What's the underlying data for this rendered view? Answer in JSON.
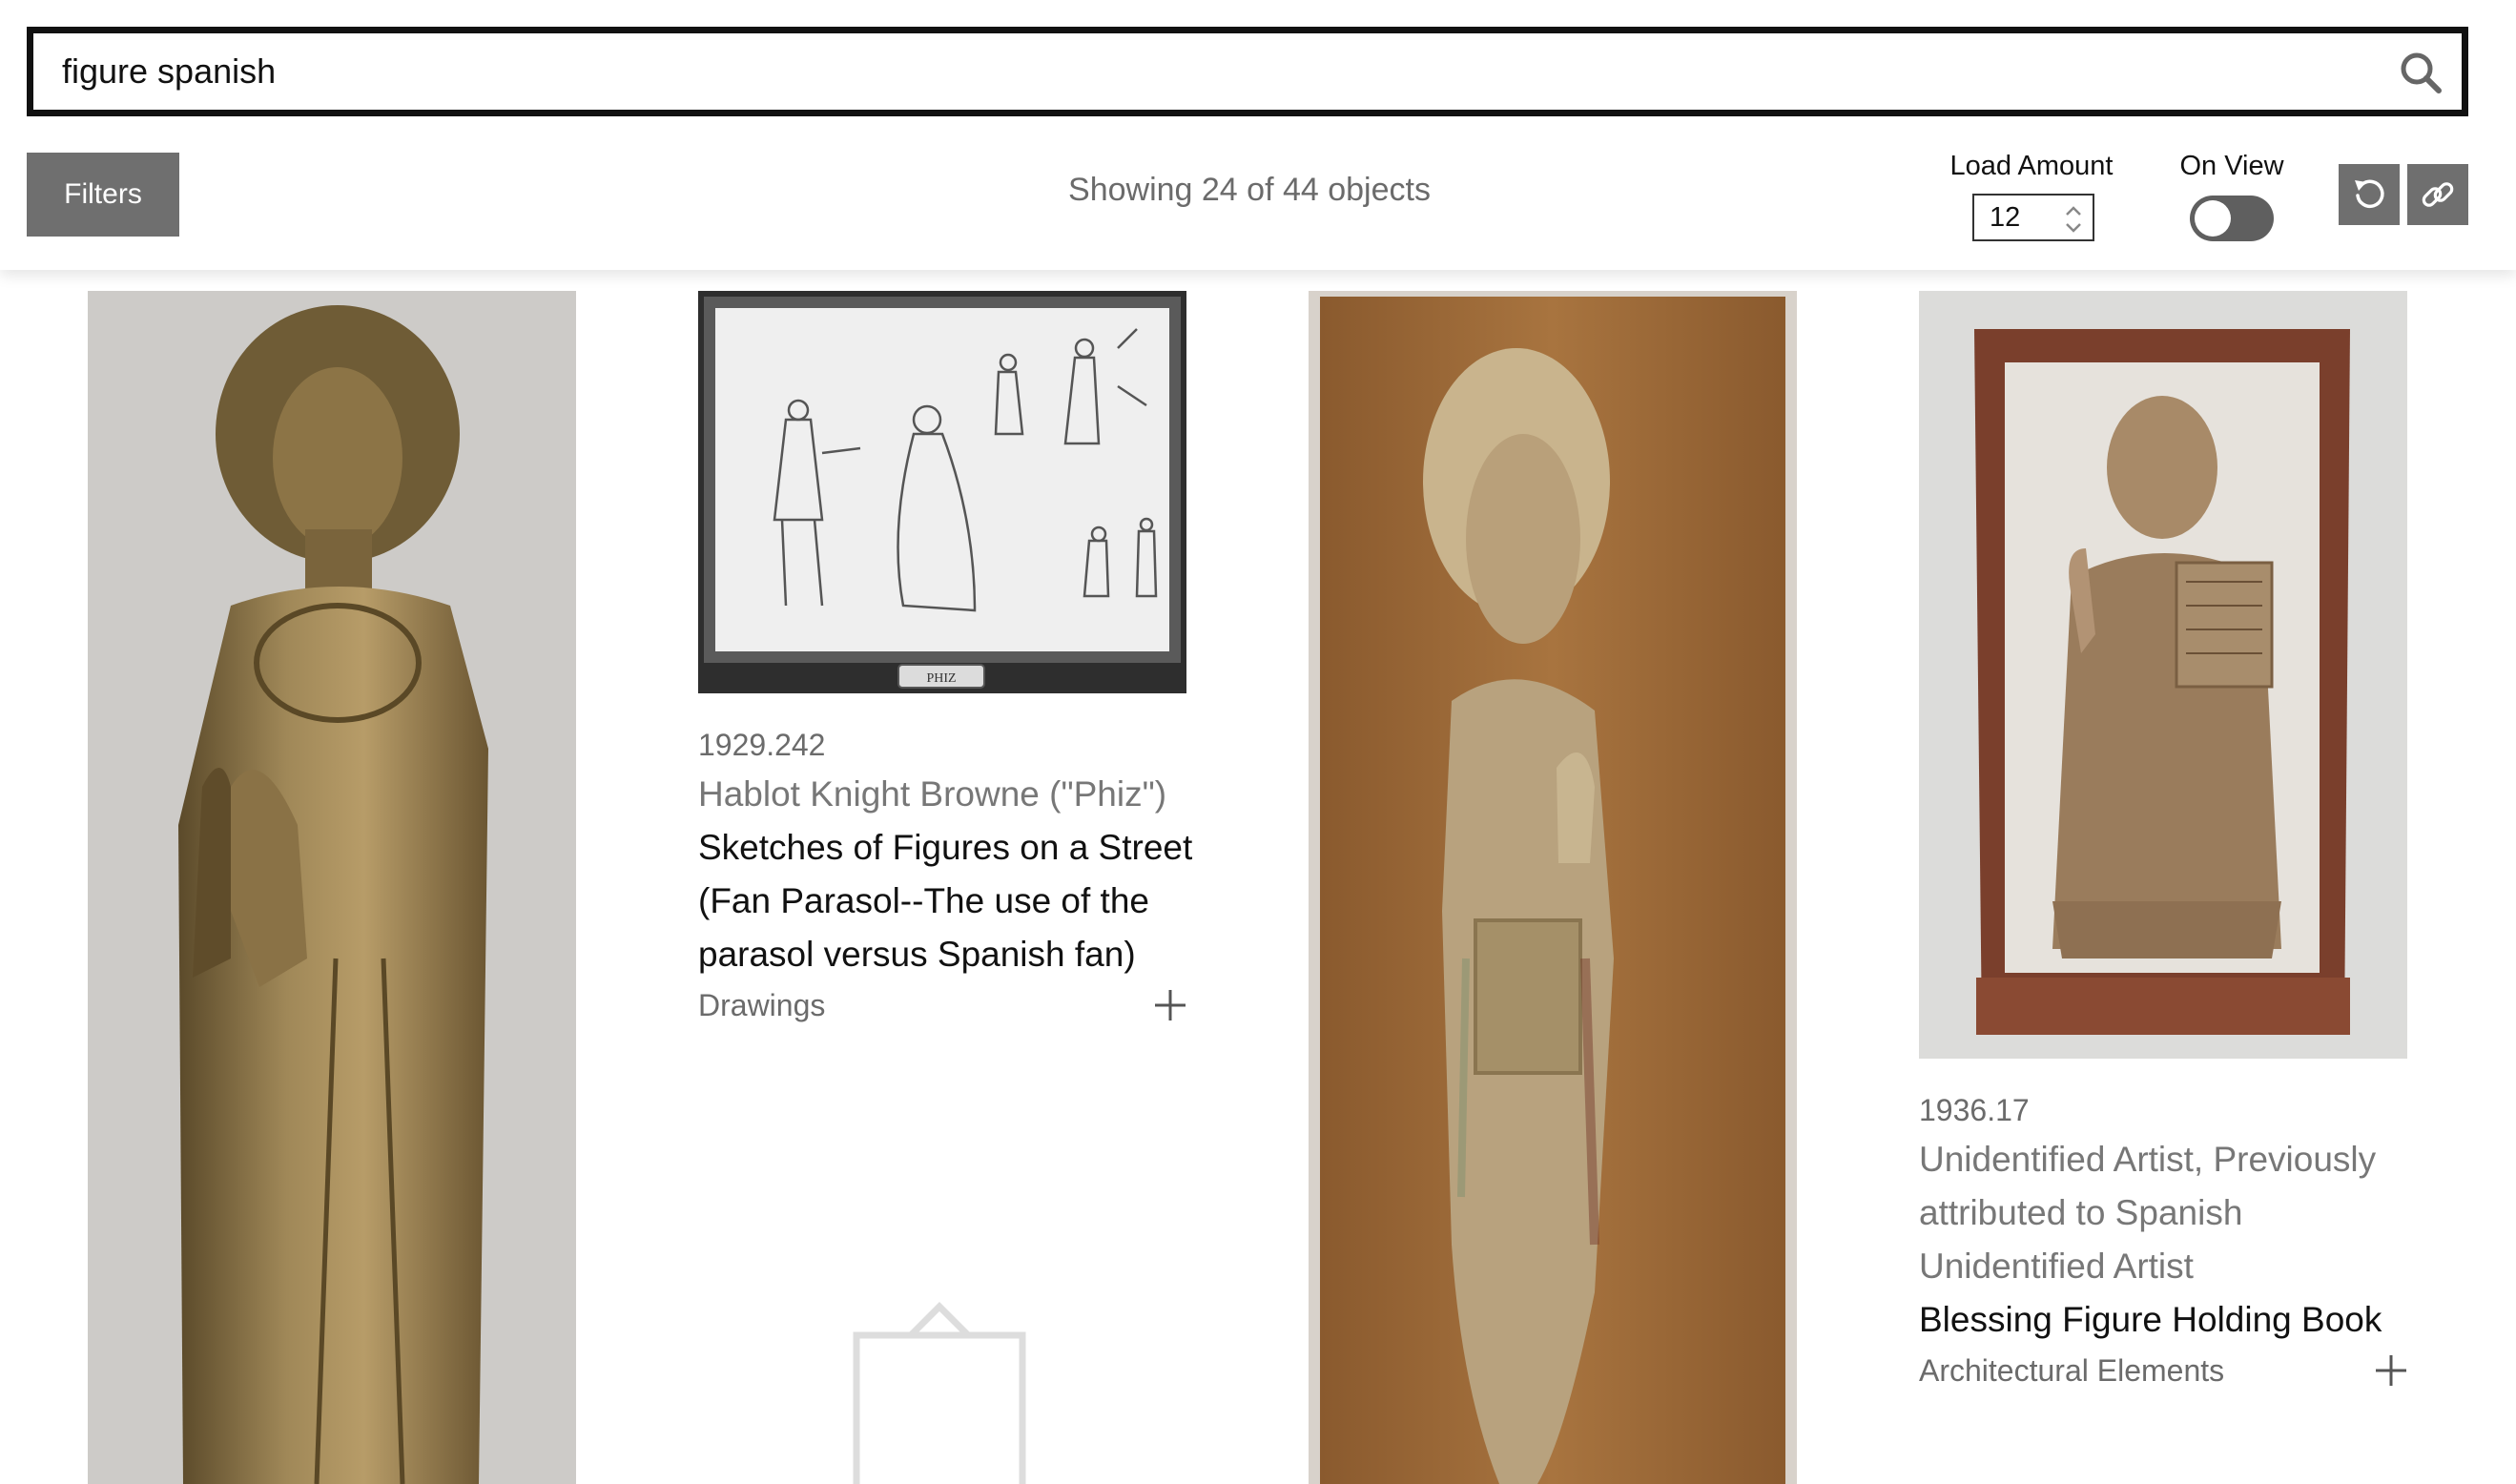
{
  "search": {
    "value": "figure spanish",
    "icon": "magnifier-icon"
  },
  "toolbar": {
    "filters_label": "Filters",
    "results_text": "Showing 24 of 44 objects",
    "load_amount_label": "Load Amount",
    "load_amount_value": "12",
    "on_view_label": "On View",
    "on_view_enabled": false,
    "reset_icon": "reset-icon",
    "link_icon": "link-icon"
  },
  "colors": {
    "button_bg": "#6f6f6f",
    "muted_text": "#6b6b6b",
    "search_border": "#111111"
  },
  "objects": [
    {
      "image_desc": "carved wooden standing figure with halo",
      "accession": "",
      "artist": "",
      "title": "",
      "department": ""
    },
    {
      "image_desc": "pencil sketch of figures on a street, framed",
      "accession": "1929.242",
      "artist": "Hablot Knight Browne (\"Phiz\")",
      "title": "Sketches of Figures on a Street (Fan Parasol--The use of the parasol versus Spanish fan)",
      "department": "Drawings",
      "frame_label": "PHIZ"
    },
    {
      "image_desc": "carved figure on wooden panel",
      "accession": "",
      "artist": "",
      "title": "",
      "department": ""
    },
    {
      "image_desc": "stone relief of blessing figure holding book in wooden frame",
      "accession": "1936.17",
      "artist": "Unidentified Artist, Previously attributed to Spanish Unidentified Artist",
      "title": "Blessing Figure Holding Book",
      "department": "Architectural Elements"
    }
  ]
}
